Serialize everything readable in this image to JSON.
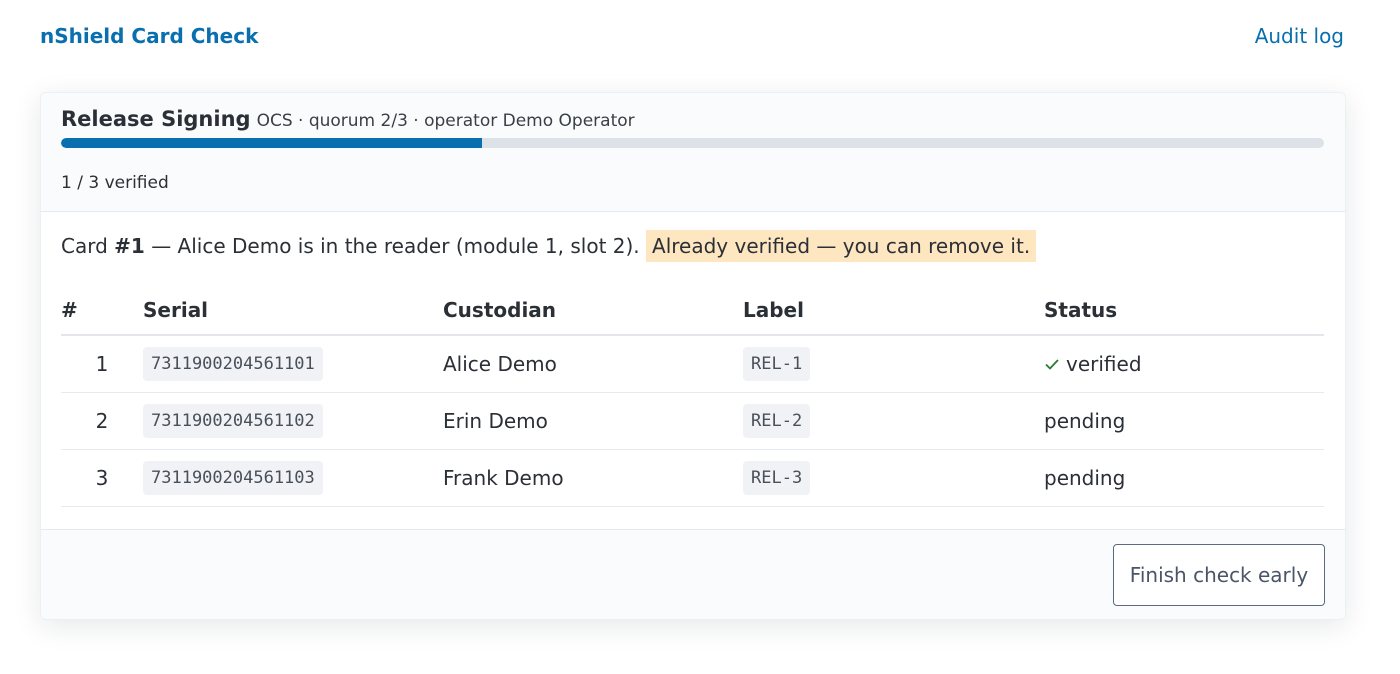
{
  "header": {
    "brand": "nShield Card Check",
    "audit_link": "Audit log"
  },
  "set": {
    "name": "Release Signing",
    "meta": "OCS · quorum 2/3 · operator Demo Operator",
    "progress_fraction": 0.3333,
    "verified_text": "1 / 3 verified"
  },
  "message": {
    "prefix": "Card ",
    "card_ref": "#1",
    "middle": " — Alice Demo is in the reader (module 1, slot 2). ",
    "notice": "Already verified — you can remove it."
  },
  "table": {
    "headers": {
      "num": "#",
      "serial": "Serial",
      "custodian": "Custodian",
      "label": "Label",
      "status": "Status"
    },
    "rows": [
      {
        "num": "1",
        "serial": "7311900204561101",
        "custodian": "Alice Demo",
        "label": "REL-1",
        "status": "verified"
      },
      {
        "num": "2",
        "serial": "7311900204561102",
        "custodian": "Erin Demo",
        "label": "REL-2",
        "status": "pending"
      },
      {
        "num": "3",
        "serial": "7311900204561103",
        "custodian": "Frank Demo",
        "label": "REL-3",
        "status": "pending"
      }
    ]
  },
  "footer": {
    "finish_label": "Finish check early"
  },
  "colors": {
    "accent": "#0a6fae",
    "verified": "#2a7a32",
    "notice_bg": "#fde6c0"
  },
  "icons": {
    "status_verified": "checkmark-icon"
  }
}
